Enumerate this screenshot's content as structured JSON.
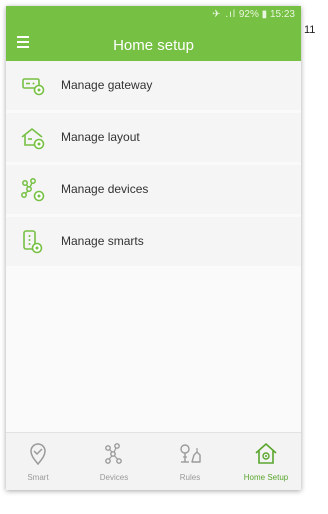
{
  "page_number": "11",
  "status_bar": {
    "signal_icons": "✈ .ıl",
    "battery": "92%",
    "battery_icon": "▮",
    "time": "15:23"
  },
  "app_bar": {
    "title": "Home setup",
    "menu_icon": "hamburger-menu-icon"
  },
  "menu": {
    "items": [
      {
        "label": "Manage gateway",
        "icon": "gateway-settings-icon"
      },
      {
        "label": "Manage layout",
        "icon": "house-settings-icon"
      },
      {
        "label": "Manage devices",
        "icon": "devices-network-icon"
      },
      {
        "label": "Manage smarts",
        "icon": "smart-device-settings-icon"
      }
    ]
  },
  "tab_bar": {
    "tabs": [
      {
        "label": "Smart",
        "icon": "location-pin-icon",
        "active": false
      },
      {
        "label": "Devices",
        "icon": "devices-network-icon",
        "active": false
      },
      {
        "label": "Rules",
        "icon": "rules-icon",
        "active": false
      },
      {
        "label": "Home Setup",
        "icon": "home-setup-icon",
        "active": true
      }
    ]
  },
  "colors": {
    "primary": "#76c043",
    "active_tab": "#5aa62e",
    "item_background": "#f5f5f5",
    "inactive_tab": "#9a9a9a"
  }
}
